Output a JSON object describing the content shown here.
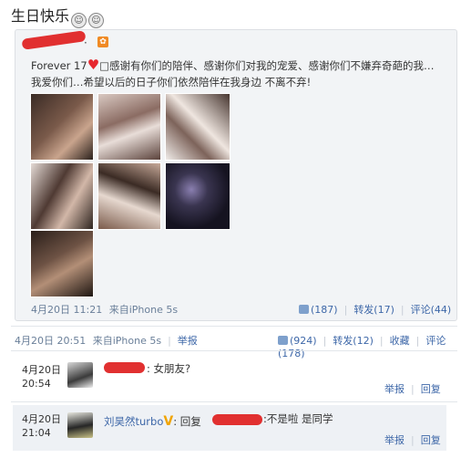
{
  "heading": {
    "text": "生日快乐",
    "emoji_1": "face-emoji",
    "emoji_2": "face-emoji"
  },
  "post": {
    "author_suffix": "·",
    "text_prefix": "Forever 17",
    "text_body": "□感谢有你们的陪伴、感谢你们对我的宠爱、感谢你们不嫌弃奇葩的我…我爱你们…希望以后的日子你们依然陪伴在我身边 不离不弃!",
    "time": "4月20日 11:21",
    "source": "来自iPhone 5s",
    "likes": "(187)",
    "repost": "转发(17)",
    "comment": "评论(44)"
  },
  "repost": {
    "time": "4月20日 20:51",
    "source": "来自iPhone 5s",
    "report": "举报",
    "likes": "(924)",
    "repost": "转发(12)",
    "favorite": "收藏",
    "comment": "评论(178)"
  },
  "comments": [
    {
      "date": "4月20日",
      "time": "20:54",
      "text": ": 女朋友?",
      "report": "举报",
      "reply": "回复"
    },
    {
      "date": "4月20日",
      "time": "21:04",
      "name": "刘昊然turbo",
      "vip": "V",
      "text_prefix": ": 回复",
      "text_suffix": ":不是啦 是同学",
      "report": "举报",
      "reply": "回复"
    }
  ],
  "colors": {
    "link": "#3d67a8",
    "redact": "#e13030",
    "card_bg": "#f2f4f6",
    "comment_bg": "#eef1f5"
  }
}
